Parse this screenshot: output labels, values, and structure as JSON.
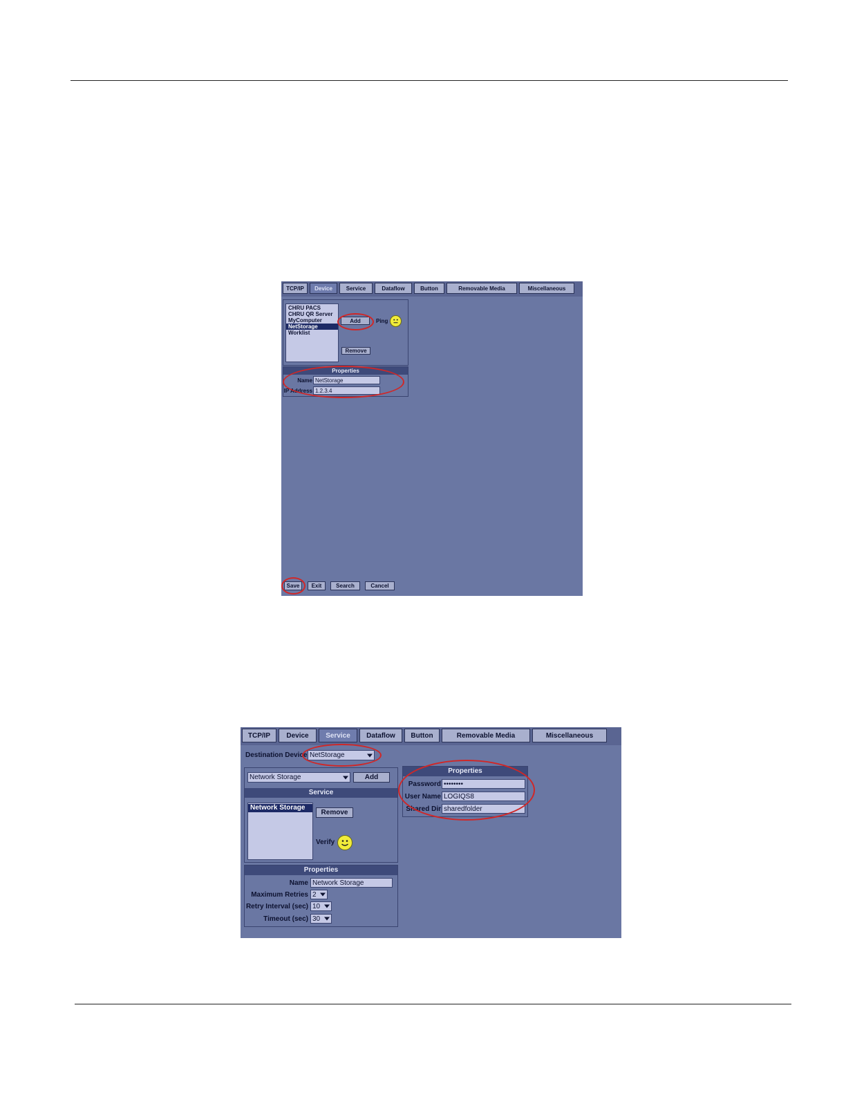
{
  "screenshot1": {
    "tabs": [
      "TCP/IP",
      "Device",
      "Service",
      "Dataflow",
      "Button",
      "Removable Media",
      "Miscellaneous"
    ],
    "active_tab": "Device",
    "device_list": [
      "CHRU PACS",
      "CHRU QR Server",
      "MyComputer",
      "NetStorage",
      "Worklist"
    ],
    "selected_device": "NetStorage",
    "add_label": "Add",
    "ping_label": "Ping",
    "remove_label": "Remove",
    "properties_header": "Properties",
    "name_label": "Name",
    "name_value": "NetStorage",
    "ip_label": "IP Address",
    "ip_value": "1.2.3.4",
    "bottom_buttons": [
      "Save",
      "Exit",
      "Search",
      "Cancel"
    ]
  },
  "screenshot2": {
    "tabs": [
      "TCP/IP",
      "Device",
      "Service",
      "Dataflow",
      "Button",
      "Removable Media",
      "Miscellaneous"
    ],
    "active_tab": "Service",
    "destination_label": "Destination Device",
    "destination_value": "NetStorage",
    "service_type_value": "Network Storage",
    "add_label": "Add",
    "service_header": "Service",
    "service_list": [
      "Network Storage"
    ],
    "remove_label": "Remove",
    "verify_label": "Verify",
    "properties_header": "Properties",
    "name_label": "Name",
    "name_value": "Network Storage",
    "max_retries_label": "Maximum Retries",
    "max_retries_value": "2",
    "retry_interval_label": "Retry Interval (sec)",
    "retry_interval_value": "10",
    "timeout_label": "Timeout (sec)",
    "timeout_value": "30",
    "right_properties_header": "Properties",
    "password_label": "Password",
    "password_value": "••••••••",
    "username_label": "User Name",
    "username_value": "LOGIQS8",
    "shared_dir_label": "Shared Dir",
    "shared_dir_value": "sharedfolder"
  },
  "colors": {
    "screen_bg": "#6a77a3",
    "tab_bg": "#a9b0ce",
    "header_bg": "#3e4a7a",
    "field_bg": "#c5c9e6",
    "selection": "#1d2a66",
    "annotation_red": "#d02727",
    "smiley": "#f1ec3a"
  }
}
